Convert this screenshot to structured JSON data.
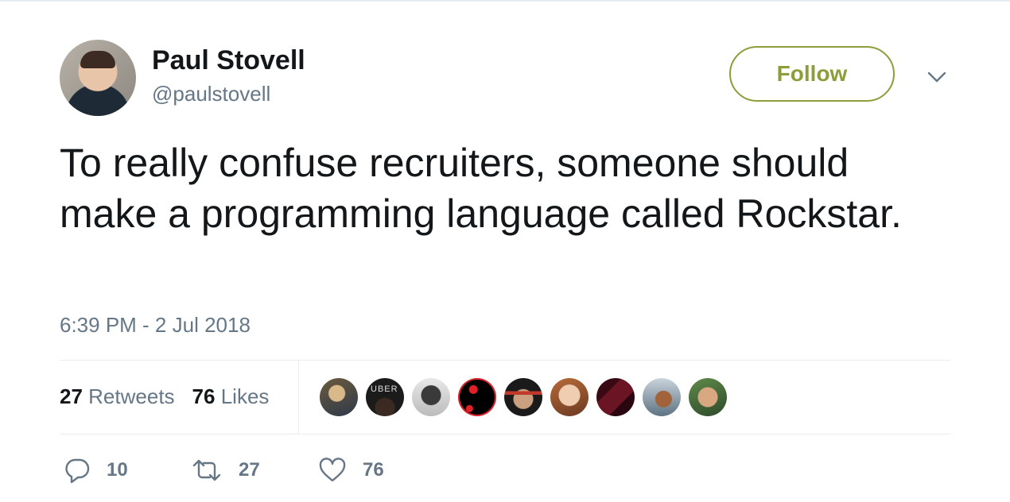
{
  "author": {
    "name": "Paul Stovell",
    "handle": "@paulstovell"
  },
  "follow_button": {
    "label": "Follow",
    "color": "#8c9d3a"
  },
  "tweet": {
    "text": "To really confuse recruiters, someone should make a programming language called Rockstar.",
    "timestamp": "6:39 PM - 2 Jul 2018"
  },
  "stats": {
    "retweets_count": "27",
    "retweets_label": "Retweets",
    "likes_count": "76",
    "likes_label": "Likes"
  },
  "likers": [
    {
      "icon": "liker-avatar-1"
    },
    {
      "icon": "liker-avatar-uber",
      "text": "UBER"
    },
    {
      "icon": "liker-avatar-3"
    },
    {
      "icon": "liker-avatar-4"
    },
    {
      "icon": "liker-avatar-5"
    },
    {
      "icon": "liker-avatar-6"
    },
    {
      "icon": "liker-avatar-7"
    },
    {
      "icon": "liker-avatar-8"
    },
    {
      "icon": "liker-avatar-9"
    }
  ],
  "actions": {
    "replies": "10",
    "retweets": "27",
    "likes": "76"
  },
  "colors": {
    "text": "#14171a",
    "muted": "#657786",
    "divider": "#e6ecf0"
  }
}
